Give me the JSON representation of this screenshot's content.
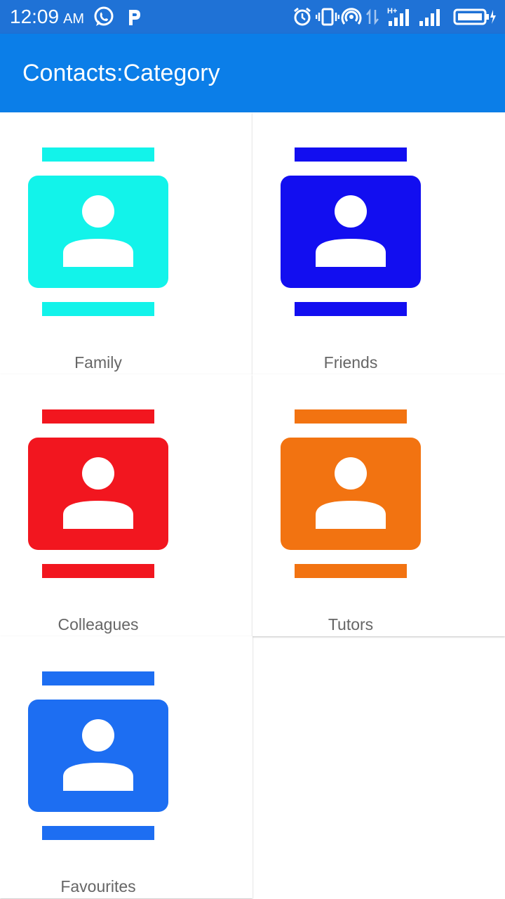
{
  "status_bar": {
    "time": "12:09",
    "ampm": "AM",
    "icons": [
      "whatsapp-icon",
      "p-icon",
      "alarm-icon",
      "vibrate-icon",
      "hotspot-icon",
      "data-arrows-icon",
      "signal-h-plus-icon",
      "signal-icon",
      "battery-charging-icon"
    ]
  },
  "app_bar": {
    "title": "Contacts:Category"
  },
  "categories": [
    {
      "label": "Family",
      "color": "#12f3ea"
    },
    {
      "label": "Friends",
      "color": "#120ef0"
    },
    {
      "label": "Colleagues",
      "color": "#f2161f"
    },
    {
      "label": "Tutors",
      "color": "#f27311"
    },
    {
      "label": "Favourites",
      "color": "#1d6ef2"
    }
  ]
}
